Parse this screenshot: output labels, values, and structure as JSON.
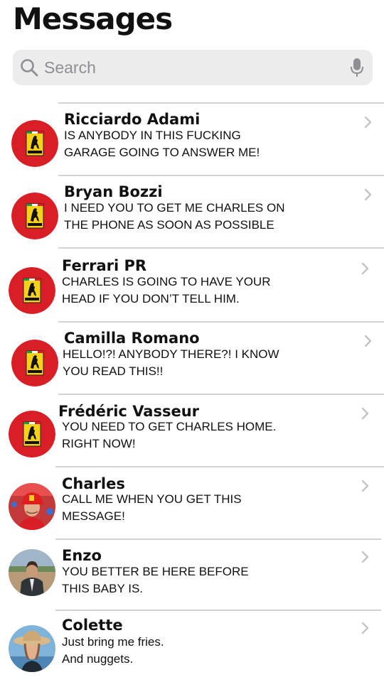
{
  "header": {
    "title": "Messages"
  },
  "search": {
    "placeholder": "Search"
  },
  "conversations": [
    {
      "name": "Ricciardo Adami",
      "line1": "IS ANYBODY IN THIS FUCKING",
      "line2": "GARAGE GOING TO ANSWER ME!",
      "avatar": "ferrari-logo"
    },
    {
      "name": "Bryan Bozzi",
      "line1": "I NEED YOU TO GET ME CHARLES ON",
      "line2": "THE PHONE AS SOON AS POSSIBLE",
      "avatar": "ferrari-logo"
    },
    {
      "name": "Ferrari PR",
      "line1": "CHARLES IS GOING TO HAVE YOUR",
      "line2": "HEAD IF YOU DON’T TELL HIM.",
      "avatar": "ferrari-logo"
    },
    {
      "name": "Camilla Romano",
      "line1": "HELLO!?! ANYBODY THERE?! I KNOW",
      "line2": "YOU READ THIS!!",
      "avatar": "ferrari-logo"
    },
    {
      "name": "Frédéric Vasseur",
      "line1": "YOU NEED TO GET CHARLES HOME.",
      "line2": "RIGHT NOW!",
      "avatar": "ferrari-logo"
    },
    {
      "name": "Charles",
      "line1": "CALL ME WHEN YOU GET THIS",
      "line2": "MESSAGE!",
      "avatar": "person-red-cap-photo"
    },
    {
      "name": "Enzo",
      "line1": "YOU BETTER BE HERE BEFORE",
      "line2": "THIS BABY IS.",
      "avatar": "person-suit-photo"
    },
    {
      "name": "Colette",
      "line1": "Just bring me fries.",
      "line2": "And nuggets.",
      "avatar": "person-sunhat-photo"
    }
  ],
  "colors": {
    "ferrari_red": "#d81f26",
    "ferrari_yellow": "#f7d117",
    "separator": "#d3d3d3",
    "search_bg": "#ececec",
    "placeholder": "#8e8e93",
    "chevron": "#c4c4c7"
  }
}
